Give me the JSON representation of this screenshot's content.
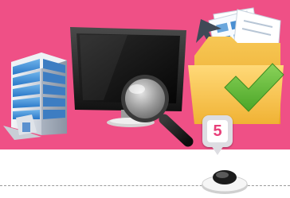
{
  "step_marker": {
    "number": "5"
  },
  "colors": {
    "banner": "#ef5086",
    "accent": "#e8407a",
    "check": "#66bb3a"
  },
  "icons": [
    "office-building-icon",
    "monitor-icon",
    "magnifier-icon",
    "folder-documents-icon",
    "checkmark-icon",
    "pushpin-button-icon"
  ]
}
